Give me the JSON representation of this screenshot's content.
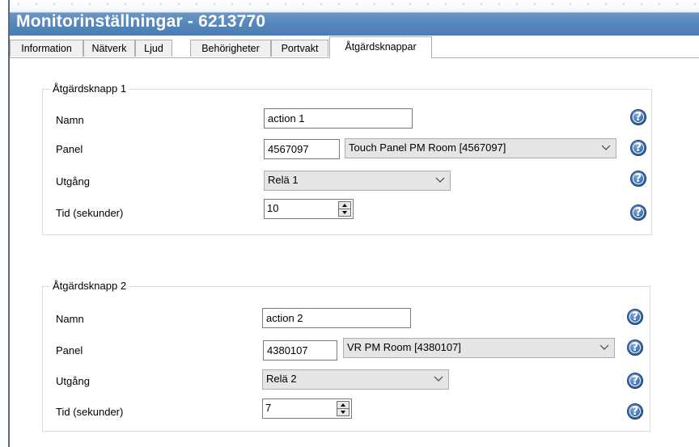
{
  "window": {
    "title": "Monitorinställningar - 6213770"
  },
  "tabs": [
    {
      "label": "Information"
    },
    {
      "label": "Nätverk"
    },
    {
      "label": "Ljud"
    },
    {
      "label": "Behörigheter"
    },
    {
      "label": "Portvakt"
    },
    {
      "label": "Åtgärdsknappar",
      "active": true
    }
  ],
  "groups": [
    {
      "title": "Åtgärdsknapp 1",
      "labels": {
        "name": "Namn",
        "panel": "Panel",
        "output": "Utgång",
        "time": "Tid (sekunder)"
      },
      "name_value": "action 1",
      "panel_id": "4567097",
      "panel_select": "Touch Panel PM Room [4567097]",
      "output_select": "Relä 1",
      "time_value": "10"
    },
    {
      "title": "Åtgärdsknapp 2",
      "labels": {
        "name": "Namn",
        "panel": "Panel",
        "output": "Utgång",
        "time": "Tid (sekunder)"
      },
      "name_value": "action 2",
      "panel_id": "4380107",
      "panel_select": "VR PM Room [4380107]",
      "output_select": "Relä 2",
      "time_value": "7"
    }
  ],
  "icons": {
    "help": "help-question-icon",
    "help_glyph": "?",
    "dropdown": "chevron-down-icon",
    "spin_up": "spin-up-icon",
    "spin_down": "spin-down-icon"
  },
  "colors": {
    "title_bar": "#4a7db5",
    "help_icon": "#3d6fae"
  }
}
